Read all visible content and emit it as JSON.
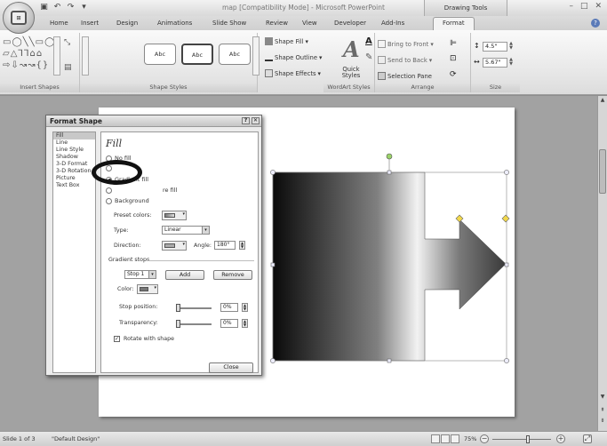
{
  "window": {
    "title": "map [Compatibility Mode] - Microsoft PowerPoint",
    "contextual_group": "Drawing Tools"
  },
  "tabs": [
    "Home",
    "Insert",
    "Design",
    "Animations",
    "Slide Show",
    "Review",
    "View",
    "Developer",
    "Add-Ins",
    "Format"
  ],
  "active_tab": "Format",
  "ribbon": {
    "groups": {
      "insert_shapes": "Insert Shapes",
      "shape_styles": "Shape Styles",
      "wordart_styles": "WordArt Styles",
      "arrange": "Arrange",
      "size": "Size"
    },
    "style_boxes": [
      "Abc",
      "Abc",
      "Abc"
    ],
    "shape_fill": "Shape Fill",
    "shape_outline": "Shape Outline",
    "shape_effects": "Shape Effects",
    "quick_styles": "Quick Styles",
    "bring_to_front": "Bring to Front",
    "send_to_back": "Send to Back",
    "selection_pane": "Selection Pane",
    "height": "4.5\"",
    "width": "5.67\""
  },
  "dialog": {
    "title": "Format Shape",
    "categories": [
      "Fill",
      "Line",
      "Line Style",
      "Shadow",
      "3-D Format",
      "3-D Rotation",
      "Picture",
      "Text Box"
    ],
    "selected_category": "Fill",
    "pane_title": "Fill",
    "fill_options": [
      "No fill",
      "Solid fill",
      "Gradient fill",
      "Picture or texture fill",
      "Background"
    ],
    "fill_visible_text": {
      "no_fill": "No fill",
      "gradient_fill": "Gradient fill",
      "picture_fill_partial": "re fill",
      "background": "Background"
    },
    "selected_fill": "Gradient fill",
    "preset_colors_label": "Preset colors:",
    "type_label": "Type:",
    "type_value": "Linear",
    "direction_label": "Direction:",
    "angle_label": "Angle:",
    "angle_value": "180°",
    "gradient_stops_label": "Gradient stops",
    "stop_value": "Stop 1",
    "add_label": "Add",
    "remove_label": "Remove",
    "color_label": "Color:",
    "stop_position_label": "Stop position:",
    "stop_position_value": "0%",
    "transparency_label": "Transparency:",
    "transparency_value": "0%",
    "rotate_label": "Rotate with shape",
    "rotate_checked": true,
    "close_label": "Close"
  },
  "statusbar": {
    "slide": "Slide 1 of 3",
    "theme": "\"Default Design\"",
    "zoom": "75%"
  }
}
